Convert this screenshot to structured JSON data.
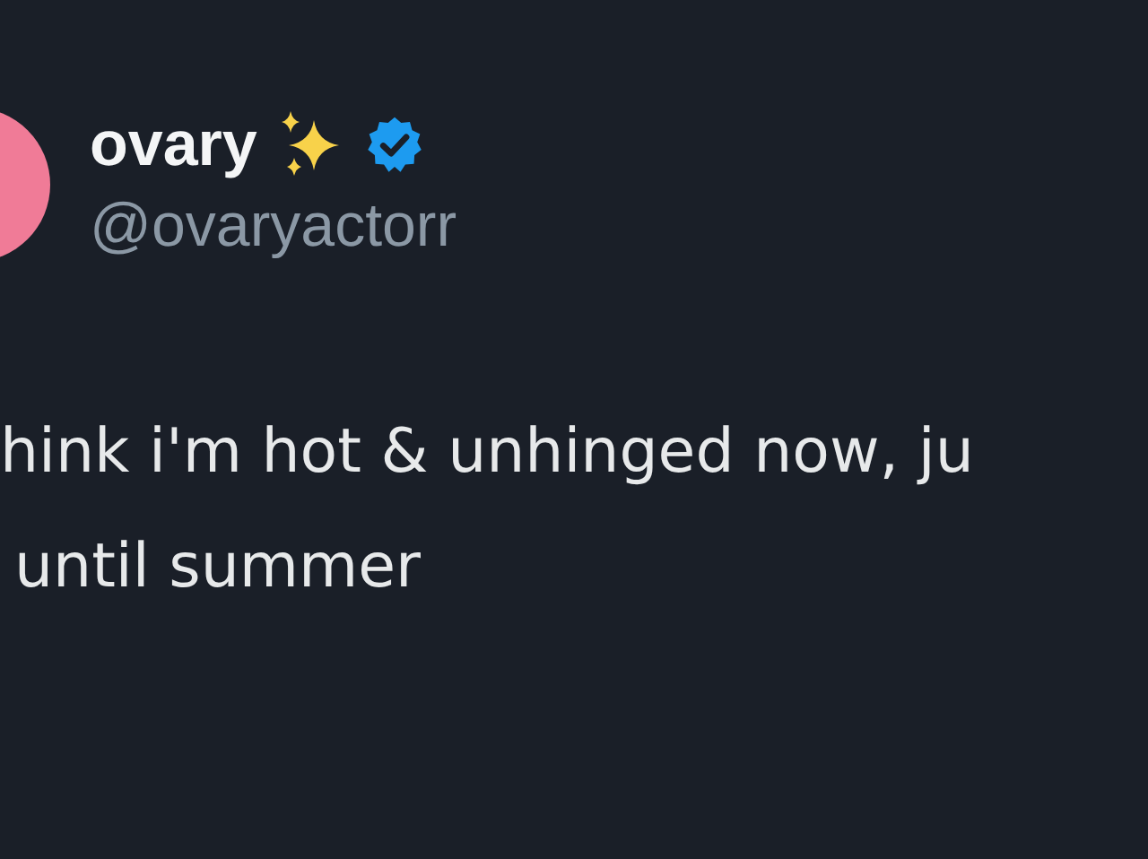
{
  "author": {
    "name": "ovary",
    "handle": "@ovaryactorr",
    "verified": true
  },
  "tweet": {
    "lines": [
      "hink i'm hot & unhinged now, ju",
      "until summer"
    ]
  }
}
